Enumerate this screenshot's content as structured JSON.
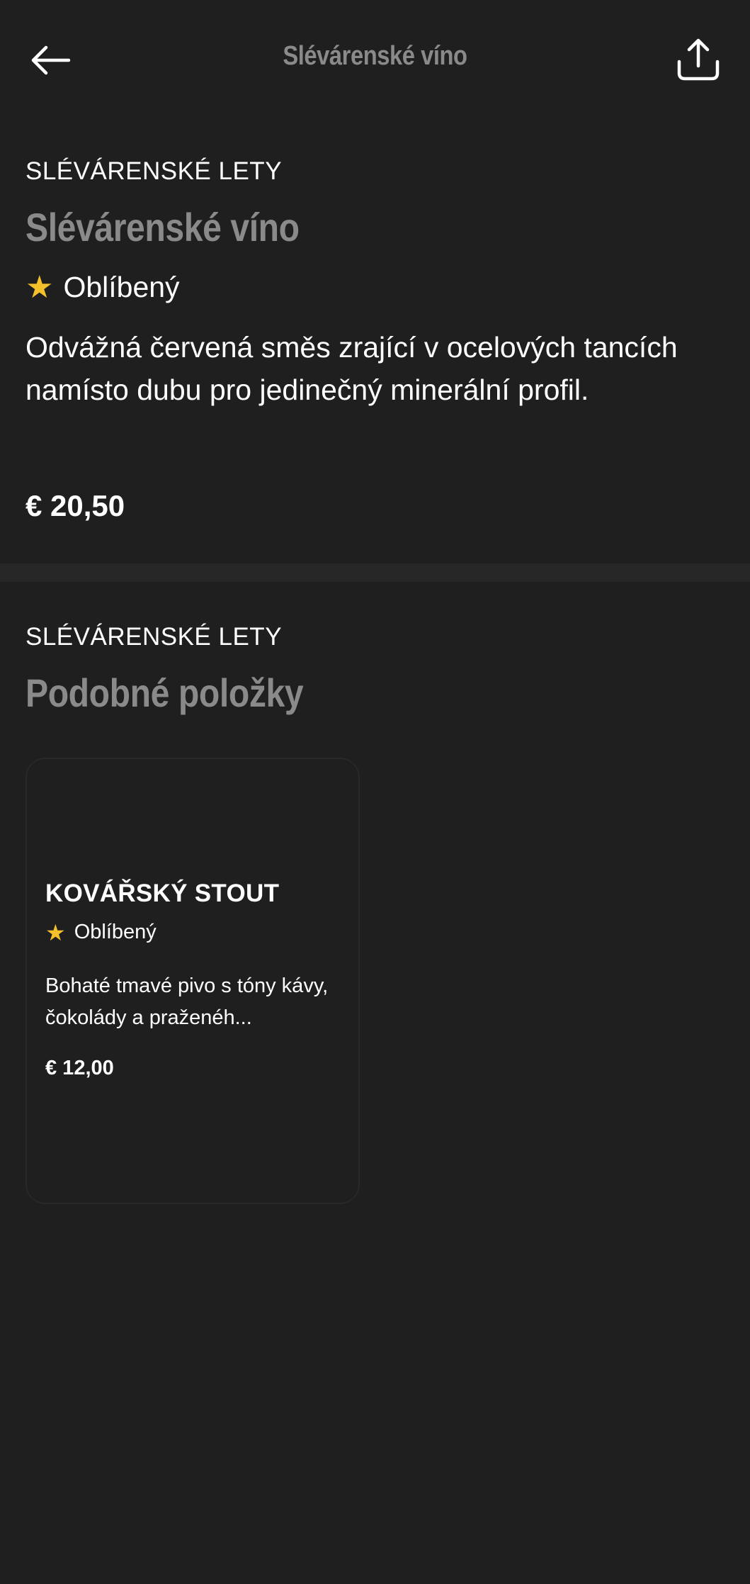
{
  "topbar": {
    "title": "Slévárenské víno",
    "back_icon": "arrow-left-icon",
    "share_icon": "share-upload-icon"
  },
  "product": {
    "category": "SLÉVÁRENSKÉ LETY",
    "name": "Slévárenské víno",
    "badge": "Oblíbený",
    "description": "Odvážná červená směs zrající v ocelových tancích namísto dubu pro jedinečný minerální profil.",
    "price": "€ 20,50"
  },
  "similar": {
    "category": "SLÉVÁRENSKÉ LETY",
    "heading": "Podobné položky",
    "items": [
      {
        "name": "KOVÁŘSKÝ STOUT",
        "badge": "Oblíbený",
        "description": "Bohaté tmavé pivo s tóny kávy, čokolády a praženéh...",
        "price": "€ 12,00"
      }
    ]
  },
  "colors": {
    "background": "#1f1f1f",
    "divider": "#272727",
    "star": "#f5c12a",
    "heading_gray": "#8a8a8a"
  }
}
